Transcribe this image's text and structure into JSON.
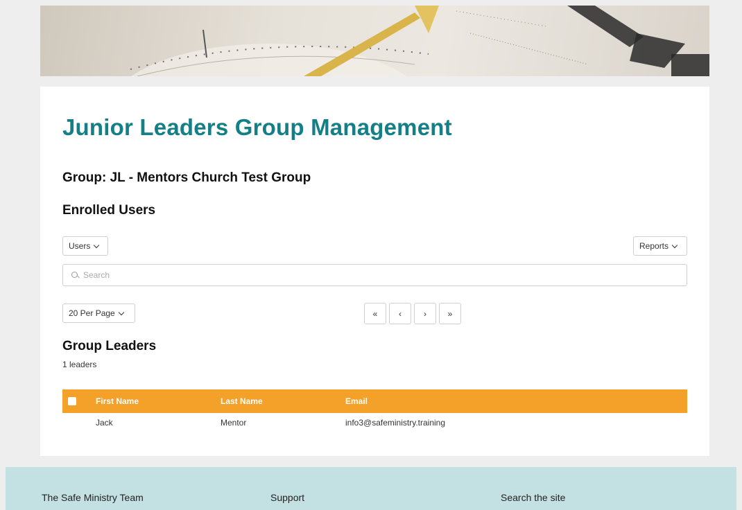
{
  "page": {
    "title": "Junior Leaders Group Management",
    "group_title": "Group: JL - Mentors Church Test Group",
    "enrolled_title": "Enrolled Users"
  },
  "toolbar": {
    "users_label": "Users",
    "reports_label": "Reports",
    "per_page_label": "20 Per Page"
  },
  "search": {
    "placeholder": "Search",
    "value": ""
  },
  "pager": {
    "first": "«",
    "prev": "‹",
    "next": "›",
    "last": "»"
  },
  "leaders": {
    "title": "Group Leaders",
    "count_text": "1 leaders",
    "columns": [
      "First Name",
      "Last Name",
      "Email"
    ],
    "rows": [
      {
        "first": "Jack",
        "last": "Mentor",
        "email": "info3@safeministry.training"
      }
    ]
  },
  "footer": {
    "col1": "The Safe Ministry Team",
    "col2": "Support",
    "col3": "Search the site"
  },
  "colors": {
    "accent": "#147f86",
    "table_header": "#f4a12a",
    "footer_bg": "#c3e1e2"
  }
}
